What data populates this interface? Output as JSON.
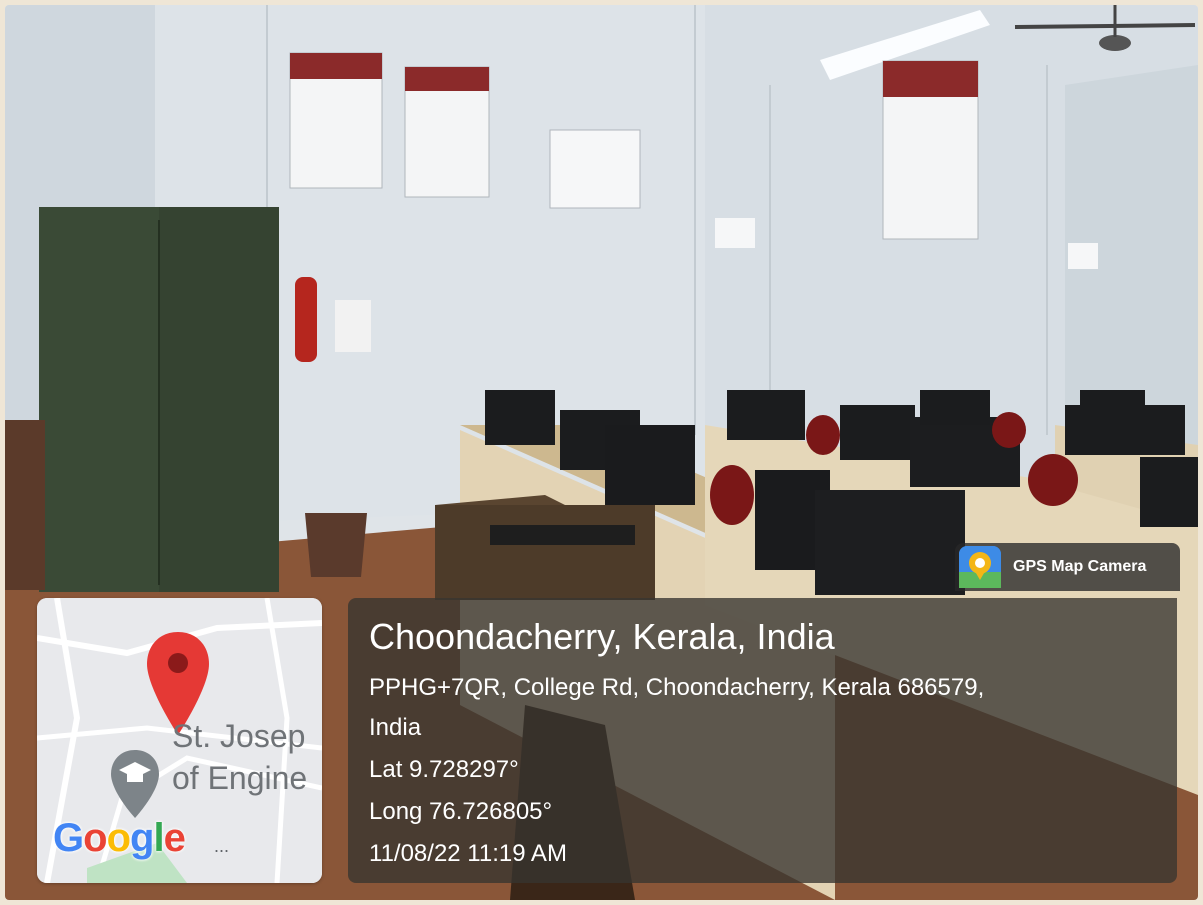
{
  "overlay": {
    "app_name": "GPS Map Camera",
    "title": "Choondacherry, Kerala, India",
    "address_line1": "PPHG+7QR, College Rd, Choondacherry, Kerala 686579,",
    "address_line2": "India",
    "latitude": "Lat 9.728297°",
    "longitude": "Long 76.726805°",
    "datetime": "11/08/22 11:19 AM"
  },
  "map": {
    "place_label_line1": "St. Josep",
    "place_label_line2": "of Engine",
    "brand": [
      "G",
      "o",
      "o",
      "g",
      "l",
      "e"
    ],
    "more": "..."
  },
  "colors": {
    "pin": "#e53935",
    "panel": "#373430",
    "badge_icon": "#2d7ee0"
  },
  "icons": [
    "map-pin-icon",
    "graduation-cap-icon",
    "gps-camera-app-icon"
  ]
}
